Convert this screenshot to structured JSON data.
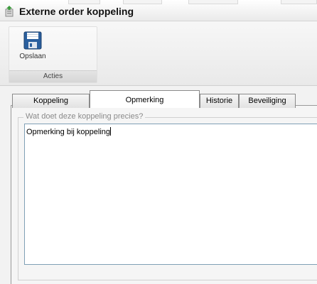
{
  "window": {
    "title": "Externe order koppeling"
  },
  "ribbon": {
    "save_label": "Opslaan",
    "group_label": "Acties"
  },
  "tabs": [
    {
      "label": "Koppeling",
      "active": false
    },
    {
      "label": "Opmerking",
      "active": true
    },
    {
      "label": "Historie",
      "active": false
    },
    {
      "label": "Beveiliging",
      "active": false
    }
  ],
  "remark": {
    "legend": "Wat doet deze koppeling precies?",
    "value": "Opmerking bij koppeling"
  },
  "colors": {
    "save_icon": "#2a5f9e",
    "focus_border": "#7fa0b5"
  }
}
